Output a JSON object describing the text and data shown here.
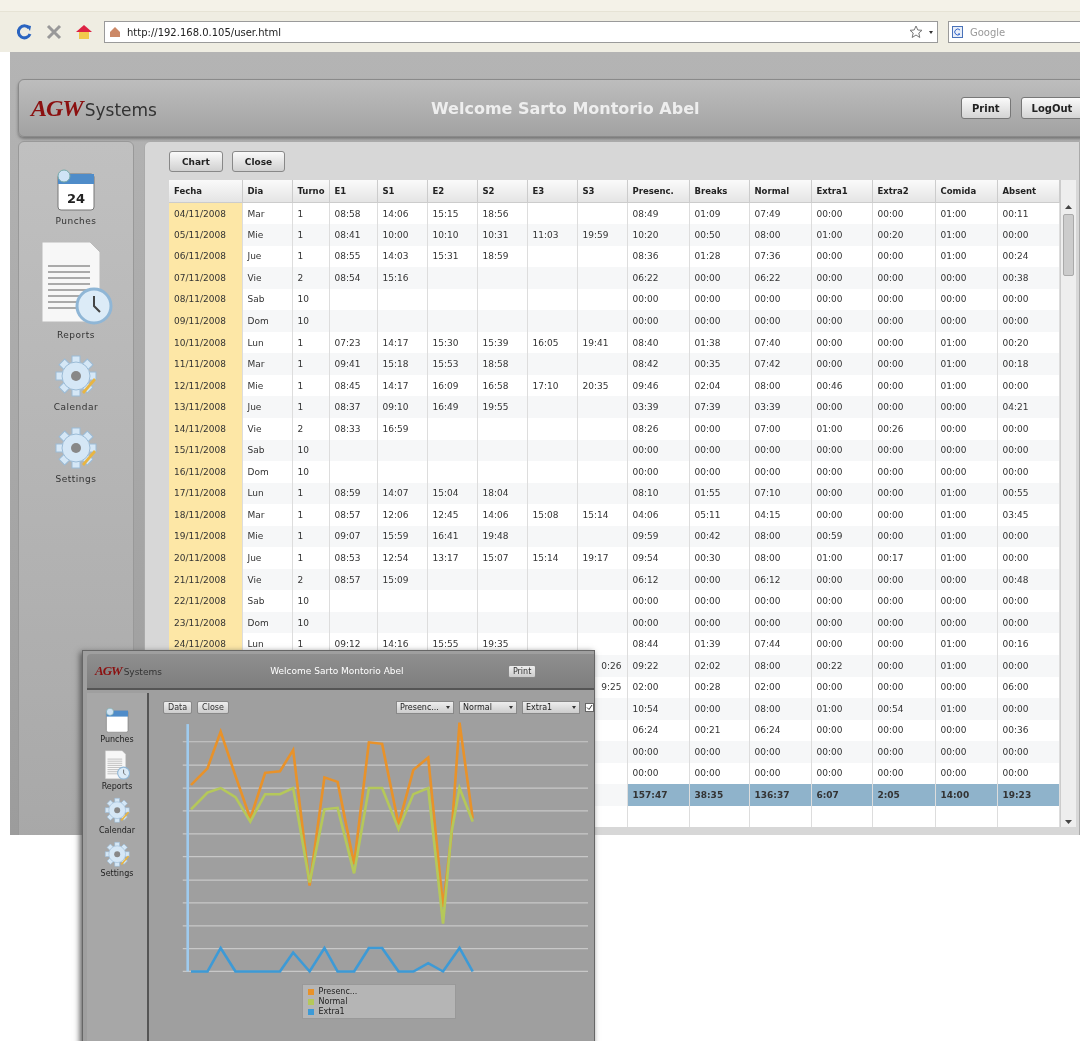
{
  "browser": {
    "url": "http://192.168.0.105/user.html",
    "search_placeholder": "Google"
  },
  "header": {
    "logo_brand": "AGW",
    "logo_word": "Systems",
    "title": "Welcome Sarto Montorio Abel",
    "buttons": [
      "Print",
      "LogOut"
    ]
  },
  "sidebar": {
    "items": [
      {
        "kind": "calendar",
        "label": "Punches",
        "icon_text": "24"
      },
      {
        "kind": "report",
        "label": "Reports"
      },
      {
        "kind": "gear",
        "label": "Calendar"
      },
      {
        "kind": "gear",
        "label": "Settings"
      }
    ]
  },
  "toolbar": {
    "buttons": [
      "Chart",
      "Close"
    ]
  },
  "table": {
    "columns": [
      "Fecha",
      "Dia",
      "Turno",
      "E1",
      "S1",
      "E2",
      "S2",
      "E3",
      "S3",
      "Presenc.",
      "Breaks",
      "Normal",
      "Extra1",
      "Extra2",
      "Comida",
      "Absent"
    ],
    "rows": [
      {
        "kind": "day",
        "cells": [
          "04/11/2008",
          "Mar",
          "1",
          "08:58",
          "14:06",
          "15:15",
          "18:56",
          null,
          null,
          "08:49",
          "01:09",
          "07:49",
          "00:00",
          "00:00",
          "01:00",
          "00:11"
        ]
      },
      {
        "kind": "day",
        "cells": [
          "05/11/2008",
          "Mie",
          "1",
          "08:41",
          "10:00",
          "10:10",
          "10:31",
          "11:03",
          "19:59",
          "10:20",
          "00:50",
          "08:00",
          "01:00",
          "00:20",
          "01:00",
          "00:00"
        ]
      },
      {
        "kind": "day",
        "cells": [
          "06/11/2008",
          "Jue",
          "1",
          "08:55",
          "14:03",
          "15:31",
          "18:59",
          null,
          null,
          "08:36",
          "01:28",
          "07:36",
          "00:00",
          "00:00",
          "01:00",
          "00:24"
        ]
      },
      {
        "kind": "day",
        "cells": [
          "07/11/2008",
          "Vie",
          "2",
          "08:54",
          "15:16",
          null,
          null,
          null,
          null,
          "06:22",
          "00:00",
          "06:22",
          "00:00",
          "00:00",
          "00:00",
          "00:38"
        ]
      },
      {
        "kind": "day",
        "cells": [
          "08/11/2008",
          "Sab",
          "10",
          null,
          null,
          null,
          null,
          null,
          null,
          "00:00",
          "00:00",
          "00:00",
          "00:00",
          "00:00",
          "00:00",
          "00:00"
        ]
      },
      {
        "kind": "day",
        "cells": [
          "09/11/2008",
          "Dom",
          "10",
          null,
          null,
          null,
          null,
          null,
          null,
          "00:00",
          "00:00",
          "00:00",
          "00:00",
          "00:00",
          "00:00",
          "00:00"
        ]
      },
      {
        "kind": "day",
        "cells": [
          "10/11/2008",
          "Lun",
          "1",
          "07:23",
          "14:17",
          "15:30",
          "15:39",
          "16:05",
          "19:41",
          "08:40",
          "01:38",
          "07:40",
          "00:00",
          "00:00",
          "01:00",
          "00:20"
        ]
      },
      {
        "kind": "day",
        "cells": [
          "11/11/2008",
          "Mar",
          "1",
          "09:41",
          "15:18",
          "15:53",
          "18:58",
          null,
          null,
          "08:42",
          "00:35",
          "07:42",
          "00:00",
          "00:00",
          "01:00",
          "00:18"
        ]
      },
      {
        "kind": "day",
        "cells": [
          "12/11/2008",
          "Mie",
          "1",
          "08:45",
          "14:17",
          "16:09",
          "16:58",
          "17:10",
          "20:35",
          "09:46",
          "02:04",
          "08:00",
          "00:46",
          "00:00",
          "01:00",
          "00:00"
        ]
      },
      {
        "kind": "day",
        "cells": [
          "13/11/2008",
          "Jue",
          "1",
          "08:37",
          "09:10",
          "16:49",
          "19:55",
          null,
          null,
          "03:39",
          "07:39",
          "03:39",
          "00:00",
          "00:00",
          "00:00",
          "04:21"
        ]
      },
      {
        "kind": "day",
        "cells": [
          "14/11/2008",
          "Vie",
          "2",
          "08:33",
          "16:59",
          null,
          null,
          null,
          null,
          "08:26",
          "00:00",
          "07:00",
          "01:00",
          "00:26",
          "00:00",
          "00:00"
        ]
      },
      {
        "kind": "day",
        "cells": [
          "15/11/2008",
          "Sab",
          "10",
          null,
          null,
          null,
          null,
          null,
          null,
          "00:00",
          "00:00",
          "00:00",
          "00:00",
          "00:00",
          "00:00",
          "00:00"
        ]
      },
      {
        "kind": "day",
        "cells": [
          "16/11/2008",
          "Dom",
          "10",
          null,
          null,
          null,
          null,
          null,
          null,
          "00:00",
          "00:00",
          "00:00",
          "00:00",
          "00:00",
          "00:00",
          "00:00"
        ]
      },
      {
        "kind": "day",
        "cells": [
          "17/11/2008",
          "Lun",
          "1",
          "08:59",
          "14:07",
          "15:04",
          "18:04",
          null,
          null,
          "08:10",
          "01:55",
          "07:10",
          "00:00",
          "00:00",
          "01:00",
          "00:55"
        ]
      },
      {
        "kind": "day",
        "cells": [
          "18/11/2008",
          "Mar",
          "1",
          "08:57",
          "12:06",
          "12:45",
          "14:06",
          "15:08",
          "15:14",
          "04:06",
          "05:11",
          "04:15",
          "00:00",
          "00:00",
          "01:00",
          "03:45"
        ]
      },
      {
        "kind": "day",
        "cells": [
          "19/11/2008",
          "Mie",
          "1",
          "09:07",
          "15:59",
          "16:41",
          "19:48",
          null,
          null,
          "09:59",
          "00:42",
          "08:00",
          "00:59",
          "00:00",
          "01:00",
          "00:00"
        ]
      },
      {
        "kind": "day",
        "cells": [
          "20/11/2008",
          "Jue",
          "1",
          "08:53",
          "12:54",
          "13:17",
          "15:07",
          "15:14",
          "19:17",
          "09:54",
          "00:30",
          "08:00",
          "01:00",
          "00:17",
          "01:00",
          "00:00"
        ]
      },
      {
        "kind": "day",
        "cells": [
          "21/11/2008",
          "Vie",
          "2",
          "08:57",
          "15:09",
          null,
          null,
          null,
          null,
          "06:12",
          "00:00",
          "06:12",
          "00:00",
          "00:00",
          "00:00",
          "00:48"
        ]
      },
      {
        "kind": "day",
        "cells": [
          "22/11/2008",
          "Sab",
          "10",
          null,
          null,
          null,
          null,
          null,
          null,
          "00:00",
          "00:00",
          "00:00",
          "00:00",
          "00:00",
          "00:00",
          "00:00"
        ]
      },
      {
        "kind": "day",
        "cells": [
          "23/11/2008",
          "Dom",
          "10",
          null,
          null,
          null,
          null,
          null,
          null,
          "00:00",
          "00:00",
          "00:00",
          "00:00",
          "00:00",
          "00:00",
          "00:00"
        ]
      },
      {
        "kind": "day",
        "cells": [
          "24/11/2008",
          "Lun",
          "1",
          "09:12",
          "14:16",
          "15:55",
          "19:35",
          null,
          null,
          "08:44",
          "01:39",
          "07:44",
          "00:00",
          "00:00",
          "01:00",
          "00:16"
        ]
      },
      {
        "kind": "day",
        "cells": [
          null,
          null,
          null,
          null,
          null,
          null,
          null,
          null,
          "0:26",
          "09:22",
          "02:02",
          "08:00",
          "00:22",
          "00:00",
          "01:00",
          "00:00"
        ]
      },
      {
        "kind": "day",
        "cells": [
          null,
          null,
          null,
          null,
          null,
          null,
          null,
          null,
          "9:25",
          "02:00",
          "00:28",
          "02:00",
          "00:00",
          "00:00",
          "00:00",
          "06:00"
        ]
      },
      {
        "kind": "day",
        "cells": [
          null,
          null,
          null,
          null,
          null,
          null,
          null,
          null,
          null,
          "10:54",
          "00:00",
          "08:00",
          "01:00",
          "00:54",
          "01:00",
          "00:00"
        ]
      },
      {
        "kind": "day",
        "cells": [
          null,
          null,
          null,
          null,
          null,
          null,
          null,
          null,
          null,
          "06:24",
          "00:21",
          "06:24",
          "00:00",
          "00:00",
          "00:00",
          "00:36"
        ]
      },
      {
        "kind": "day",
        "cells": [
          null,
          null,
          null,
          null,
          null,
          null,
          null,
          null,
          null,
          "00:00",
          "00:00",
          "00:00",
          "00:00",
          "00:00",
          "00:00",
          "00:00"
        ]
      },
      {
        "kind": "day",
        "cells": [
          null,
          null,
          null,
          null,
          null,
          null,
          null,
          null,
          null,
          "00:00",
          "00:00",
          "00:00",
          "00:00",
          "00:00",
          "00:00",
          "00:00"
        ]
      },
      {
        "kind": "total",
        "cells": [
          null,
          null,
          null,
          null,
          null,
          null,
          null,
          null,
          null,
          "157:47",
          "38:35",
          "136:37",
          "6:07",
          "2:05",
          "14:00",
          "19:23"
        ]
      }
    ]
  },
  "inset": {
    "header": {
      "logo_brand": "AGW",
      "logo_word": "Systems",
      "title": "Welcome Sarto Montorio Abel",
      "button": "Print"
    },
    "sidebar": [
      "Punches",
      "Reports",
      "Calendar",
      "Settings"
    ],
    "buttons": [
      "Data",
      "Close"
    ],
    "selects": [
      "Presenc...",
      "Normal",
      "Extra1"
    ],
    "checkbox": {
      "checked": true
    },
    "legend": [
      {
        "label": "Presenc...",
        "color": "#e8922a"
      },
      {
        "label": "Normal",
        "color": "#b5c85a"
      },
      {
        "label": "Extra1",
        "color": "#3d9ad6"
      }
    ]
  }
}
